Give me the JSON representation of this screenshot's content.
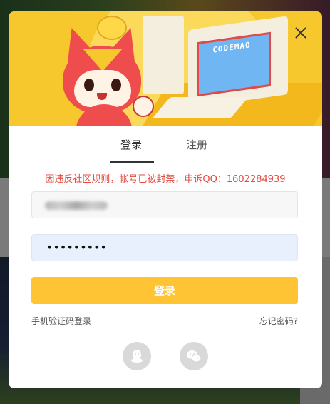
{
  "modal": {
    "banner_screen_text": "CODEMAO",
    "close_icon": "close-icon"
  },
  "tabs": {
    "login_label": "登录",
    "register_label": "注册",
    "active": "login"
  },
  "error": {
    "message": "因违反社区规则，帐号已被封禁，申诉QQ：1602284939",
    "color": "#e34a3f"
  },
  "form": {
    "username_value": "(blurred)",
    "password_masked": "•••••••••",
    "submit_label": "登录",
    "accent_color": "#fec433"
  },
  "links": {
    "sms_login": "手机验证码登录",
    "forgot_password": "忘记密码?"
  },
  "social": [
    {
      "name": "qq",
      "icon": "qq-icon"
    },
    {
      "name": "wechat",
      "icon": "wechat-icon"
    }
  ]
}
